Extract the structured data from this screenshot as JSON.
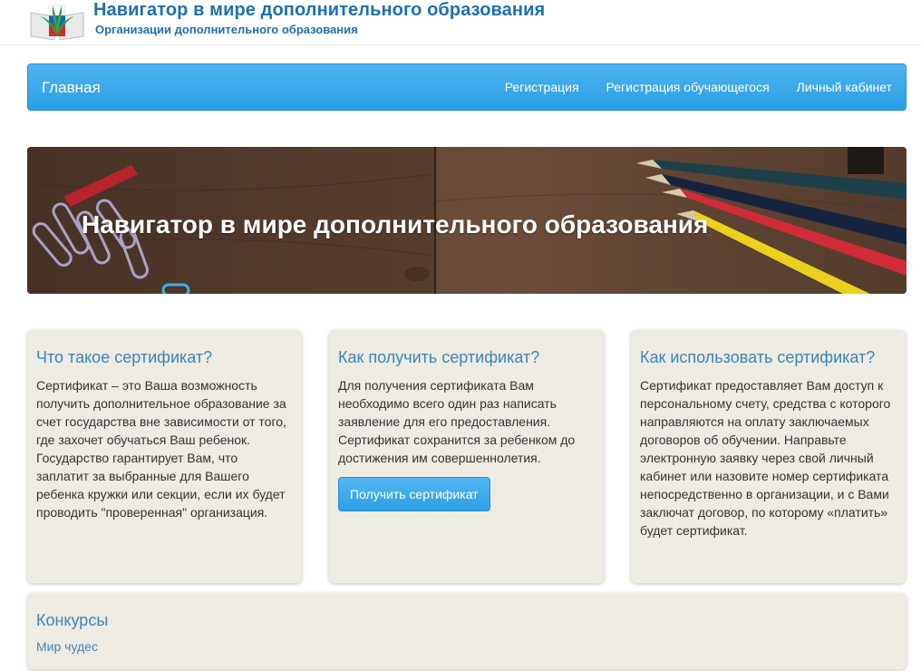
{
  "header": {
    "title": "Навигатор в мире дополнительного образования",
    "subtitle": "Организации дополнительного образования"
  },
  "navbar": {
    "brand": "Главная",
    "links": [
      "Регистрация",
      "Регистрация обучающегося",
      "Личный кабинет"
    ]
  },
  "hero": {
    "title": "Навигатор в мире дополнительного образования"
  },
  "cards": [
    {
      "title": "Что такое сертификат?",
      "text": "Сертификат – это Ваша возможность получить дополнительное образование за счет государства вне зависимости от того, где захочет обучаться Ваш ребенок. Государство гарантирует Вам, что заплатит за выбранные для Вашего ребенка кружки или секции, если их будет проводить \"проверенная\" организация."
    },
    {
      "title": "Как получить сертификат?",
      "text": "Для получения сертификата Вам необходимо всего один раз написать заявление для его предоставления. Сертификат сохранится за ребенком до достижения им совершеннолетия.",
      "button": "Получить сертификат"
    },
    {
      "title": "Как использовать сертификат?",
      "text": "Сертификат предоставляет Вам доступ к персональному счету, средства с которого направляются на оплату заключаемых договоров об обучении. Направьте электронную заявку через свой личный кабинет или назовите номер сертификата непосредственно в организации, и с Вами заключат договор, по которому «платить» будет сертификат."
    }
  ],
  "contests": {
    "title": "Конкурсы",
    "link": "Мир чудес"
  },
  "colors": {
    "navbar": "#2a9fe4",
    "title_blue": "#1f6fb2",
    "heading_blue": "#3a86b8",
    "card_bg": "#eeebe3"
  }
}
